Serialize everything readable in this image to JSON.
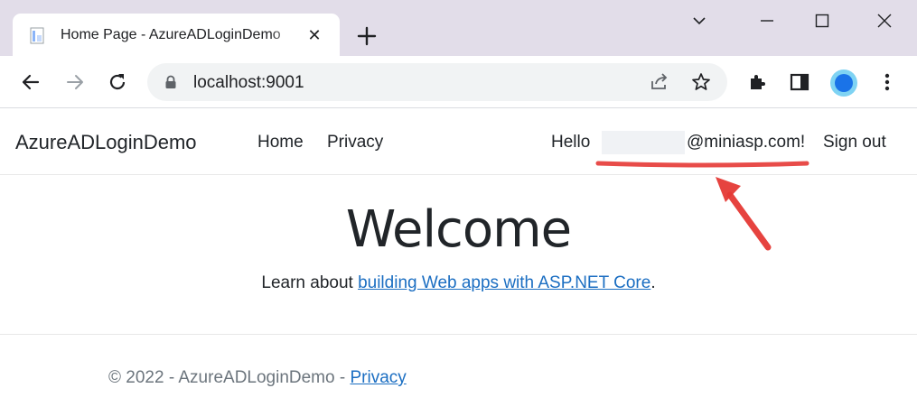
{
  "browser": {
    "tab_title": "Home Page - AzureADLoginDemo",
    "tab_close_glyph": "✕",
    "url": "localhost:9001",
    "accent_color": "#1a73e8",
    "icons": [
      "page-icon",
      "close-icon",
      "plus-icon",
      "chevron-down-icon",
      "minimize-icon",
      "maximize-icon",
      "window-close-icon",
      "back-icon",
      "forward-icon",
      "reload-icon",
      "lock-icon",
      "share-icon",
      "star-icon",
      "extensions-icon",
      "side-panel-icon",
      "profile-icon",
      "menu-icon"
    ]
  },
  "page": {
    "brand": "AzureADLoginDemo",
    "nav": {
      "home": "Home",
      "privacy": "Privacy"
    },
    "user": {
      "hello": "Hello",
      "email_domain": "@miniasp.com!",
      "sign_out": "Sign out"
    },
    "main": {
      "title": "Welcome",
      "learn_prefix": "Learn about ",
      "learn_link": "building Web apps with ASP.NET Core",
      "learn_suffix": "."
    },
    "footer": {
      "copyright": "© 2022 - AzureADLoginDemo - ",
      "privacy_link": "Privacy"
    },
    "link_color": "#1b6ec2"
  },
  "annotation": {
    "color": "#e53935"
  }
}
